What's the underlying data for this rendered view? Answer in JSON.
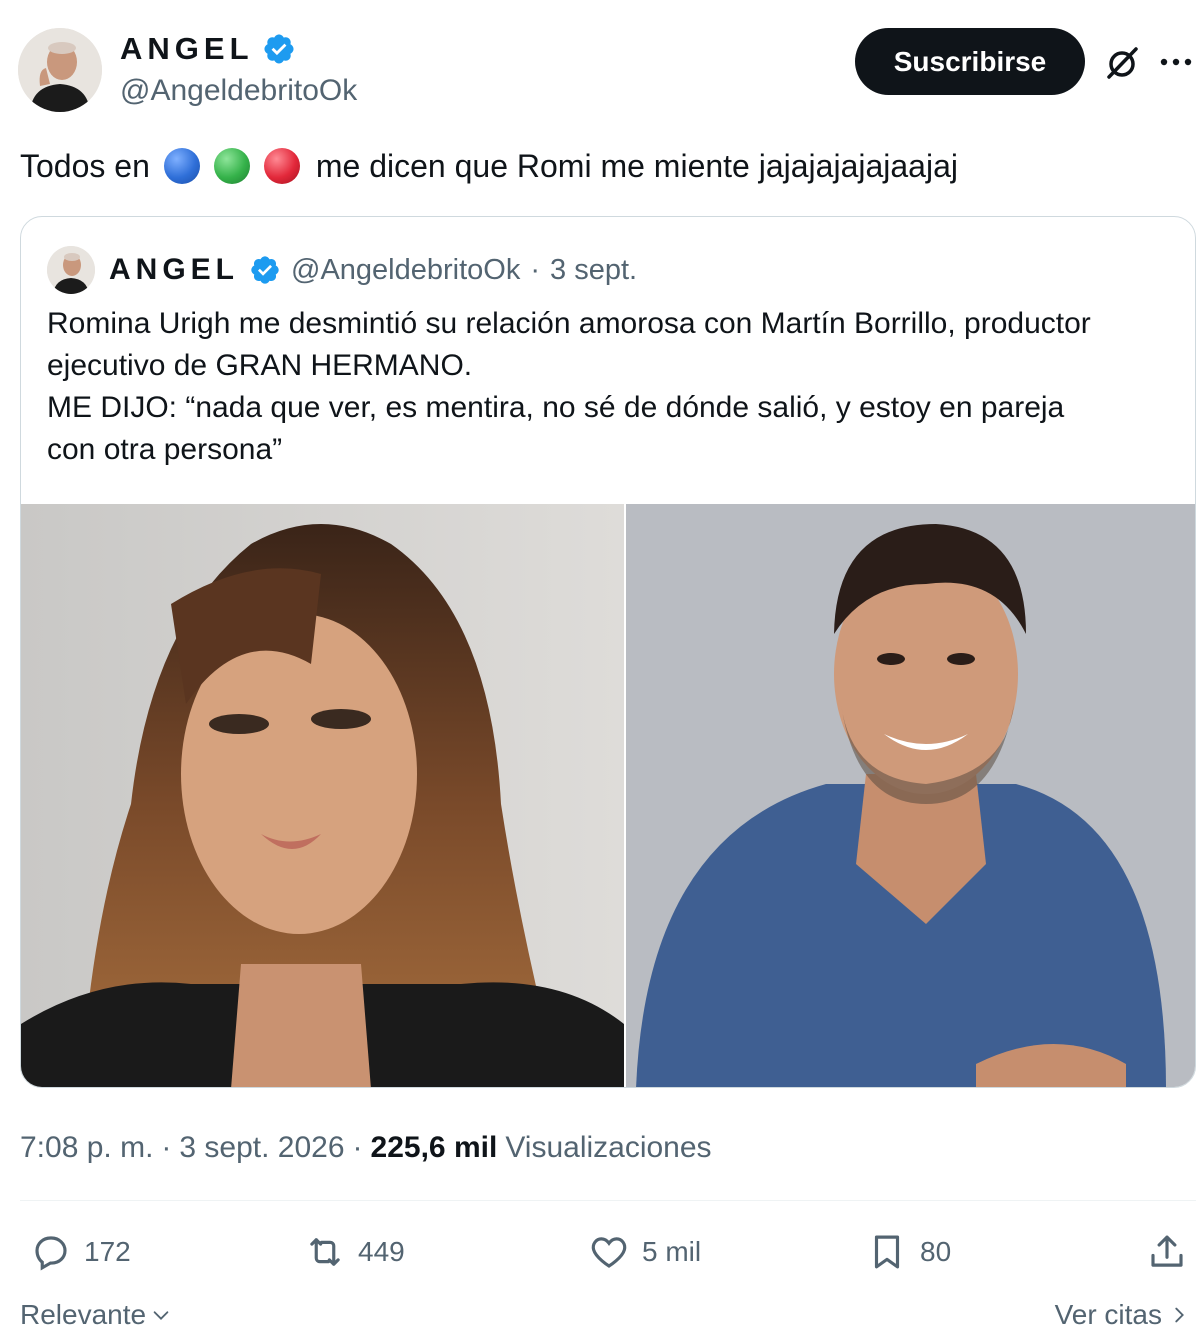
{
  "author": {
    "display_name": "ANGEL",
    "handle": "@AngeldebritoOk",
    "verified": true
  },
  "header": {
    "subscribe_label": "Suscribirse",
    "grok_icon": "grok-slash-icon",
    "more_icon": "more-dots-icon"
  },
  "tweet": {
    "text_before": "Todos en",
    "emoji_dots": [
      {
        "name": "blue-circle",
        "color": "#2f6fd8"
      },
      {
        "name": "green-circle",
        "color": "#35b24a"
      },
      {
        "name": "red-circle",
        "color": "#e2283a"
      }
    ],
    "text_after": "me dicen que Romi me miente jajajajajajaajaj"
  },
  "quoted": {
    "display_name": "ANGEL",
    "handle": "@AngeldebritoOk",
    "separator": "·",
    "date": "3 sept.",
    "lines": [
      "Romina Urigh me desmintió su relación amorosa con Martín Borrillo, productor",
      "ejecutivo de GRAN HERMANO.",
      "ME DIJO: “nada que ver, es mentira, no sé de dónde salió, y estoy en pareja",
      "con otra persona”"
    ]
  },
  "meta": {
    "time": "7:08 p. m.",
    "sep": "·",
    "date": "3 sept. 2026",
    "views_count": "225,6 mil",
    "views_label": "Visualizaciones"
  },
  "actions": {
    "replies": "172",
    "reposts": "449",
    "likes": "5 mil",
    "bookmarks": "80"
  },
  "footer": {
    "sort_label": "Relevante",
    "quotes_label": "Ver citas"
  },
  "colors": {
    "verified_blue": "#1d9bf0",
    "text_primary": "#0f1419",
    "text_secondary": "#536471"
  }
}
